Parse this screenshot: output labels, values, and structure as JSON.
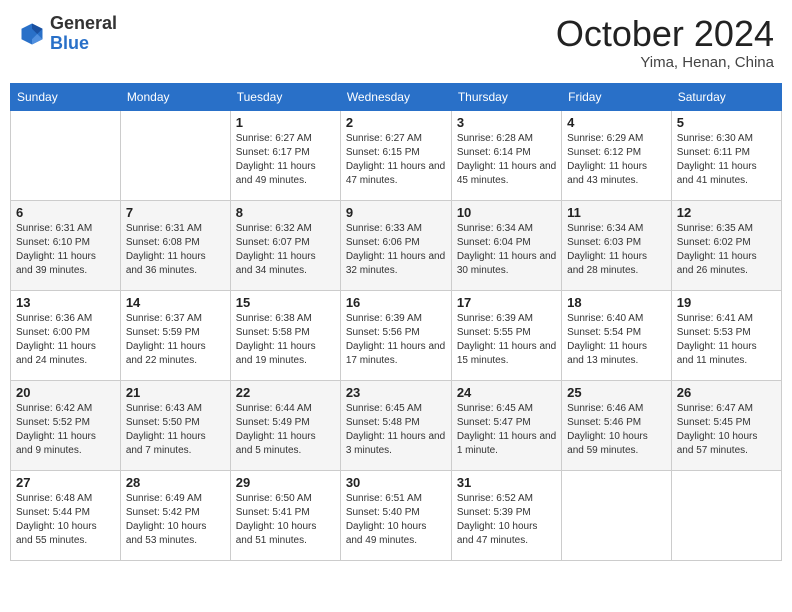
{
  "logo": {
    "general": "General",
    "blue": "Blue"
  },
  "header": {
    "month": "October 2024",
    "location": "Yima, Henan, China"
  },
  "weekdays": [
    "Sunday",
    "Monday",
    "Tuesday",
    "Wednesday",
    "Thursday",
    "Friday",
    "Saturday"
  ],
  "weeks": [
    [
      null,
      null,
      {
        "day": "1",
        "sunrise": "Sunrise: 6:27 AM",
        "sunset": "Sunset: 6:17 PM",
        "daylight": "Daylight: 11 hours and 49 minutes."
      },
      {
        "day": "2",
        "sunrise": "Sunrise: 6:27 AM",
        "sunset": "Sunset: 6:15 PM",
        "daylight": "Daylight: 11 hours and 47 minutes."
      },
      {
        "day": "3",
        "sunrise": "Sunrise: 6:28 AM",
        "sunset": "Sunset: 6:14 PM",
        "daylight": "Daylight: 11 hours and 45 minutes."
      },
      {
        "day": "4",
        "sunrise": "Sunrise: 6:29 AM",
        "sunset": "Sunset: 6:12 PM",
        "daylight": "Daylight: 11 hours and 43 minutes."
      },
      {
        "day": "5",
        "sunrise": "Sunrise: 6:30 AM",
        "sunset": "Sunset: 6:11 PM",
        "daylight": "Daylight: 11 hours and 41 minutes."
      }
    ],
    [
      {
        "day": "6",
        "sunrise": "Sunrise: 6:31 AM",
        "sunset": "Sunset: 6:10 PM",
        "daylight": "Daylight: 11 hours and 39 minutes."
      },
      {
        "day": "7",
        "sunrise": "Sunrise: 6:31 AM",
        "sunset": "Sunset: 6:08 PM",
        "daylight": "Daylight: 11 hours and 36 minutes."
      },
      {
        "day": "8",
        "sunrise": "Sunrise: 6:32 AM",
        "sunset": "Sunset: 6:07 PM",
        "daylight": "Daylight: 11 hours and 34 minutes."
      },
      {
        "day": "9",
        "sunrise": "Sunrise: 6:33 AM",
        "sunset": "Sunset: 6:06 PM",
        "daylight": "Daylight: 11 hours and 32 minutes."
      },
      {
        "day": "10",
        "sunrise": "Sunrise: 6:34 AM",
        "sunset": "Sunset: 6:04 PM",
        "daylight": "Daylight: 11 hours and 30 minutes."
      },
      {
        "day": "11",
        "sunrise": "Sunrise: 6:34 AM",
        "sunset": "Sunset: 6:03 PM",
        "daylight": "Daylight: 11 hours and 28 minutes."
      },
      {
        "day": "12",
        "sunrise": "Sunrise: 6:35 AM",
        "sunset": "Sunset: 6:02 PM",
        "daylight": "Daylight: 11 hours and 26 minutes."
      }
    ],
    [
      {
        "day": "13",
        "sunrise": "Sunrise: 6:36 AM",
        "sunset": "Sunset: 6:00 PM",
        "daylight": "Daylight: 11 hours and 24 minutes."
      },
      {
        "day": "14",
        "sunrise": "Sunrise: 6:37 AM",
        "sunset": "Sunset: 5:59 PM",
        "daylight": "Daylight: 11 hours and 22 minutes."
      },
      {
        "day": "15",
        "sunrise": "Sunrise: 6:38 AM",
        "sunset": "Sunset: 5:58 PM",
        "daylight": "Daylight: 11 hours and 19 minutes."
      },
      {
        "day": "16",
        "sunrise": "Sunrise: 6:39 AM",
        "sunset": "Sunset: 5:56 PM",
        "daylight": "Daylight: 11 hours and 17 minutes."
      },
      {
        "day": "17",
        "sunrise": "Sunrise: 6:39 AM",
        "sunset": "Sunset: 5:55 PM",
        "daylight": "Daylight: 11 hours and 15 minutes."
      },
      {
        "day": "18",
        "sunrise": "Sunrise: 6:40 AM",
        "sunset": "Sunset: 5:54 PM",
        "daylight": "Daylight: 11 hours and 13 minutes."
      },
      {
        "day": "19",
        "sunrise": "Sunrise: 6:41 AM",
        "sunset": "Sunset: 5:53 PM",
        "daylight": "Daylight: 11 hours and 11 minutes."
      }
    ],
    [
      {
        "day": "20",
        "sunrise": "Sunrise: 6:42 AM",
        "sunset": "Sunset: 5:52 PM",
        "daylight": "Daylight: 11 hours and 9 minutes."
      },
      {
        "day": "21",
        "sunrise": "Sunrise: 6:43 AM",
        "sunset": "Sunset: 5:50 PM",
        "daylight": "Daylight: 11 hours and 7 minutes."
      },
      {
        "day": "22",
        "sunrise": "Sunrise: 6:44 AM",
        "sunset": "Sunset: 5:49 PM",
        "daylight": "Daylight: 11 hours and 5 minutes."
      },
      {
        "day": "23",
        "sunrise": "Sunrise: 6:45 AM",
        "sunset": "Sunset: 5:48 PM",
        "daylight": "Daylight: 11 hours and 3 minutes."
      },
      {
        "day": "24",
        "sunrise": "Sunrise: 6:45 AM",
        "sunset": "Sunset: 5:47 PM",
        "daylight": "Daylight: 11 hours and 1 minute."
      },
      {
        "day": "25",
        "sunrise": "Sunrise: 6:46 AM",
        "sunset": "Sunset: 5:46 PM",
        "daylight": "Daylight: 10 hours and 59 minutes."
      },
      {
        "day": "26",
        "sunrise": "Sunrise: 6:47 AM",
        "sunset": "Sunset: 5:45 PM",
        "daylight": "Daylight: 10 hours and 57 minutes."
      }
    ],
    [
      {
        "day": "27",
        "sunrise": "Sunrise: 6:48 AM",
        "sunset": "Sunset: 5:44 PM",
        "daylight": "Daylight: 10 hours and 55 minutes."
      },
      {
        "day": "28",
        "sunrise": "Sunrise: 6:49 AM",
        "sunset": "Sunset: 5:42 PM",
        "daylight": "Daylight: 10 hours and 53 minutes."
      },
      {
        "day": "29",
        "sunrise": "Sunrise: 6:50 AM",
        "sunset": "Sunset: 5:41 PM",
        "daylight": "Daylight: 10 hours and 51 minutes."
      },
      {
        "day": "30",
        "sunrise": "Sunrise: 6:51 AM",
        "sunset": "Sunset: 5:40 PM",
        "daylight": "Daylight: 10 hours and 49 minutes."
      },
      {
        "day": "31",
        "sunrise": "Sunrise: 6:52 AM",
        "sunset": "Sunset: 5:39 PM",
        "daylight": "Daylight: 10 hours and 47 minutes."
      },
      null,
      null
    ]
  ]
}
